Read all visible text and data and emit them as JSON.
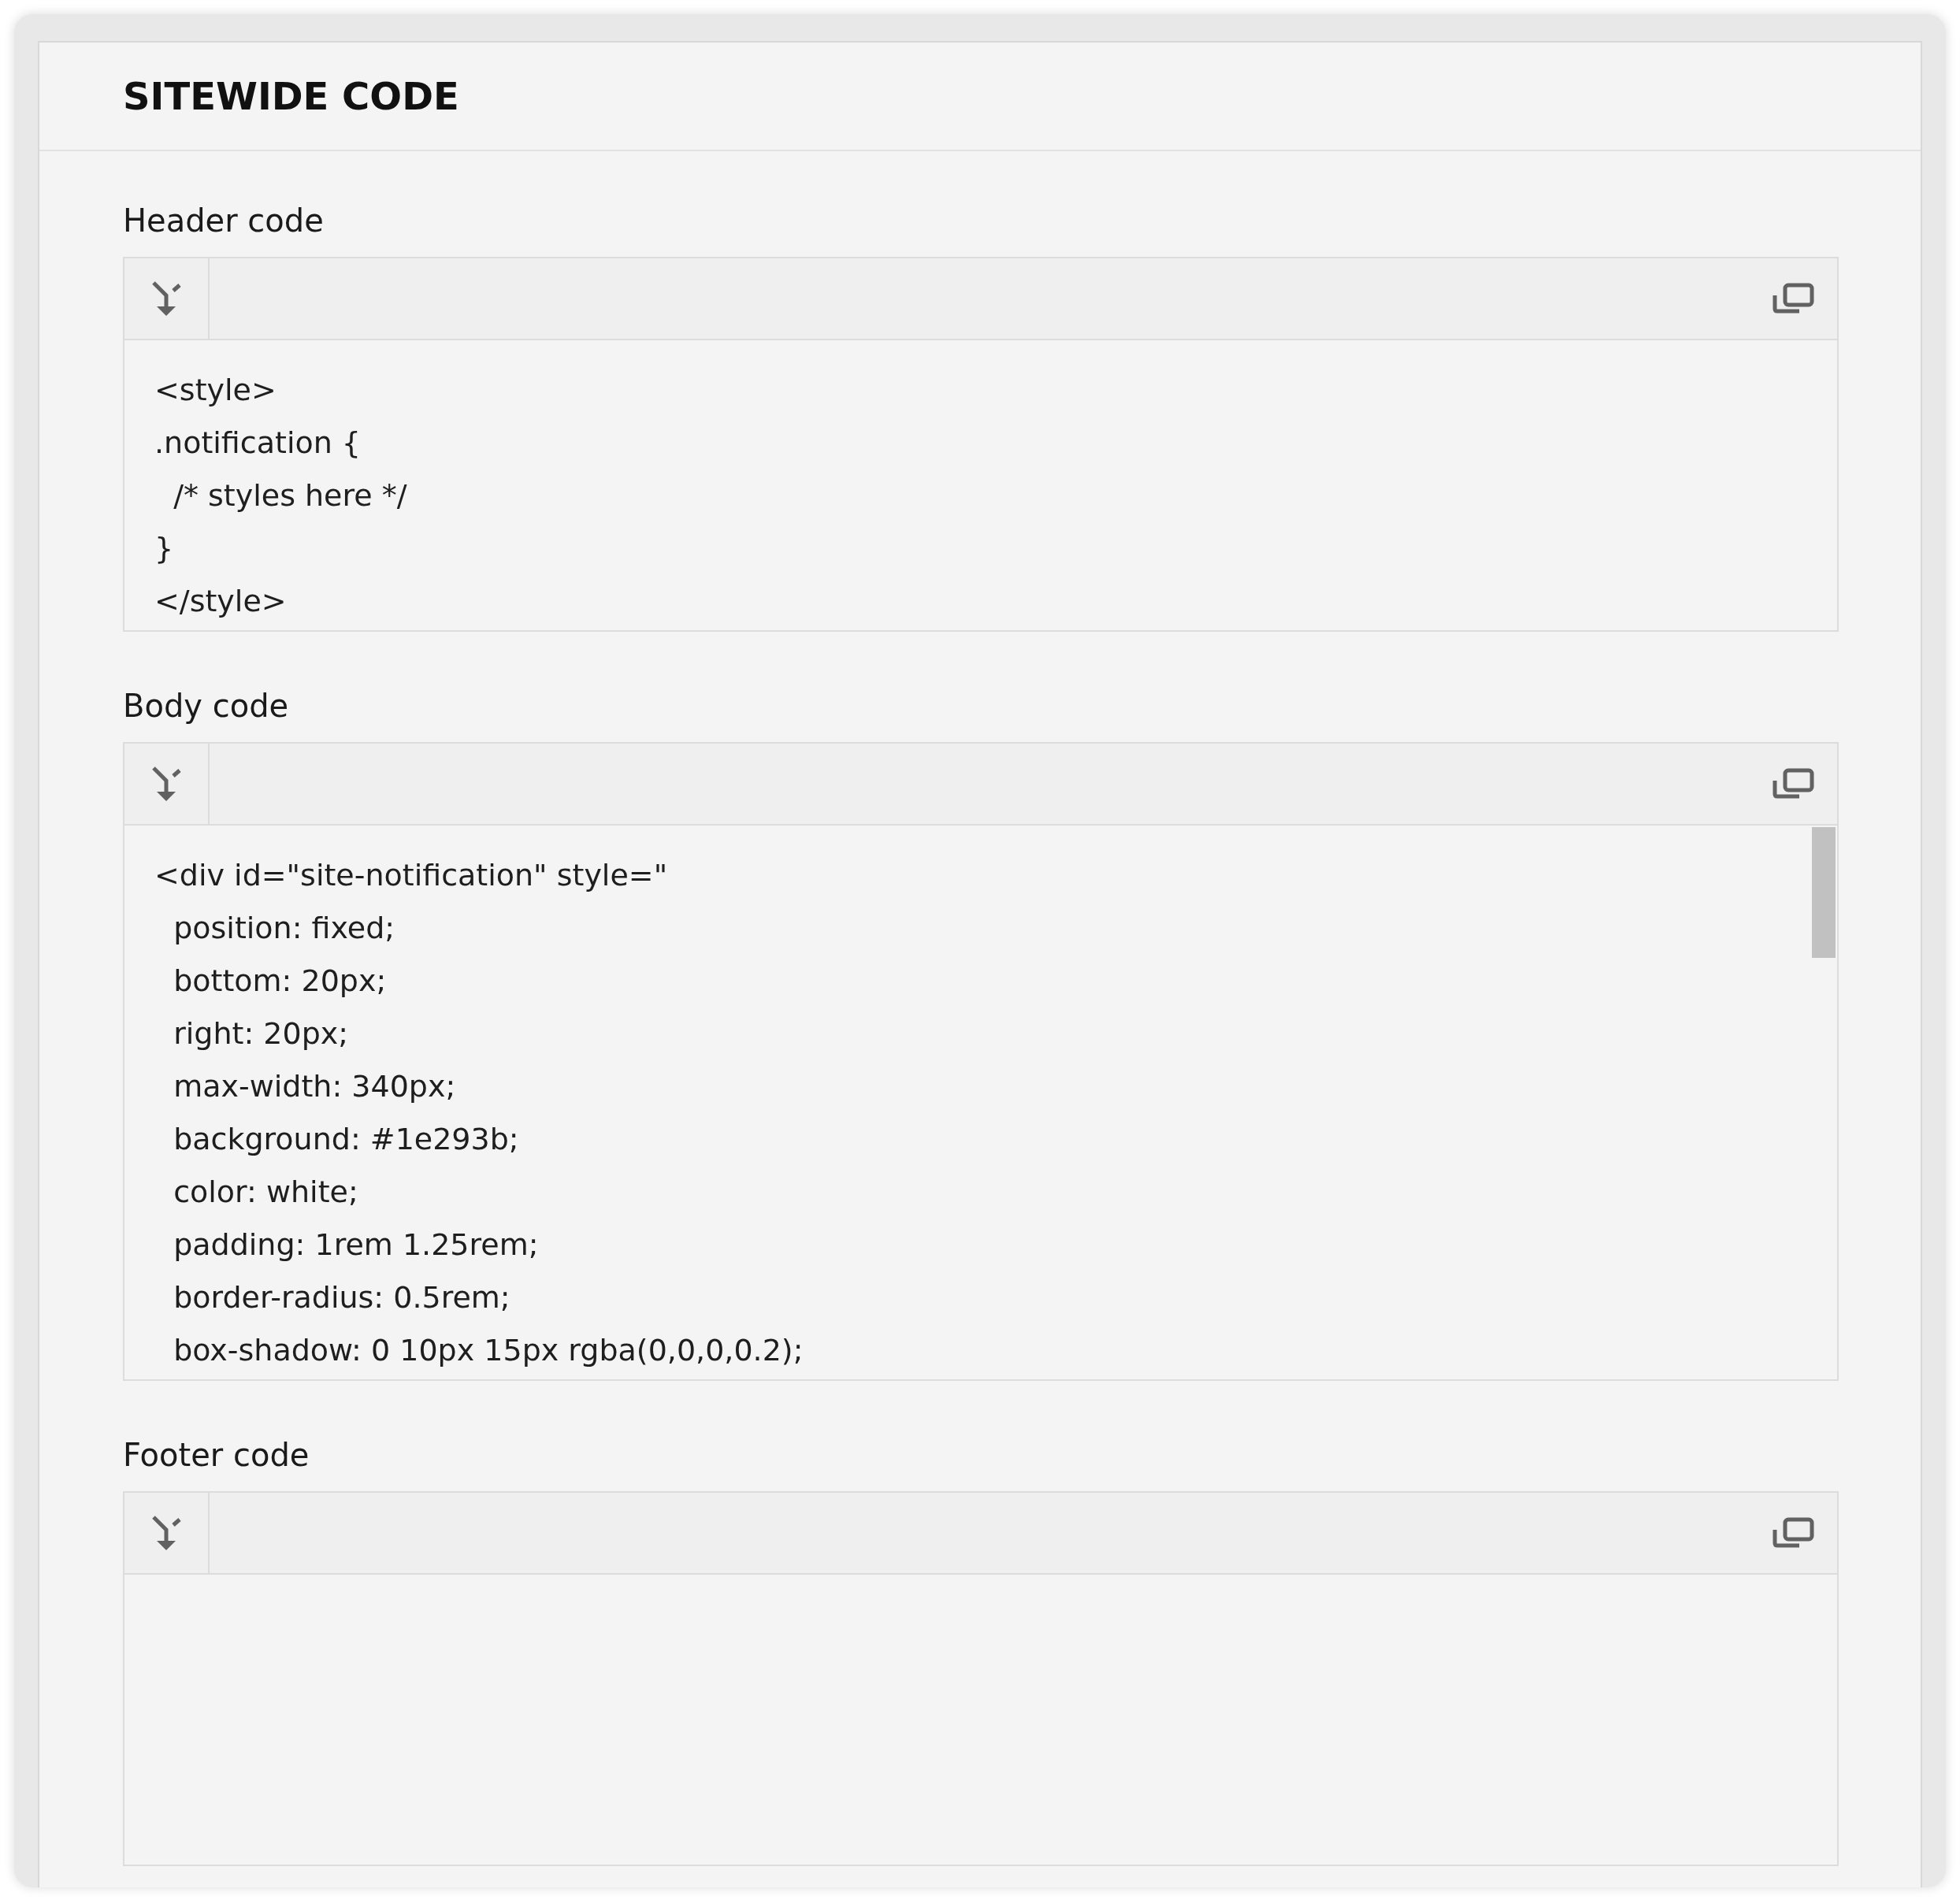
{
  "panel": {
    "title": "SITEWIDE CODE"
  },
  "editors": [
    {
      "label": "Header code",
      "scrollbar": false,
      "lines": [
        "<style>",
        ".notification {",
        "  /* styles here */",
        "}",
        "</style>"
      ]
    },
    {
      "label": "Body code",
      "scrollbar": true,
      "lines": [
        "<div id=\"site-notification\" style=\"",
        "  position: fixed;",
        "  bottom: 20px;",
        "  right: 20px;",
        "  max-width: 340px;",
        "  background: #1e293b;",
        "  color: white;",
        "  padding: 1rem 1.25rem;",
        "  border-radius: 0.5rem;",
        "  box-shadow: 0 10px 15px rgba(0,0,0,0.2);"
      ]
    },
    {
      "label": "Footer code",
      "scrollbar": false
    }
  ]
}
